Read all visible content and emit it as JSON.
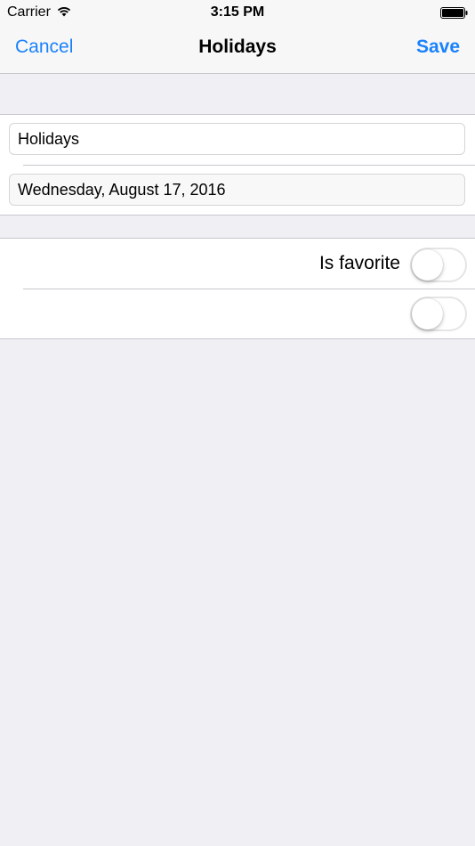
{
  "status_bar": {
    "carrier": "Carrier",
    "time": "3:15 PM",
    "wifi_icon": "wifi-icon",
    "battery_icon": "battery-icon"
  },
  "nav": {
    "cancel_label": "Cancel",
    "title": "Holidays",
    "save_label": "Save"
  },
  "form": {
    "name_value": "Holidays",
    "date_value": "Wednesday, August 17, 2016"
  },
  "switches": [
    {
      "label": "Is favorite",
      "on": false
    },
    {
      "label": "",
      "on": false
    }
  ],
  "colors": {
    "accent": "#1a82fb",
    "background": "#efeff4",
    "separator": "#c8c7cc"
  }
}
